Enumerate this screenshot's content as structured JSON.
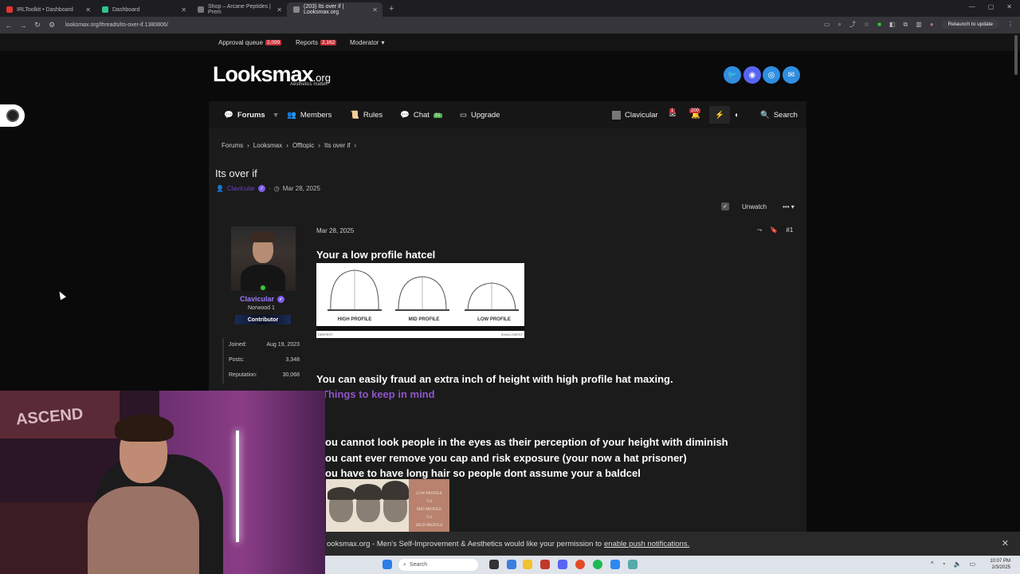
{
  "browser": {
    "tabs": [
      {
        "label": "IRLToolkit • Dashboard",
        "color": "#e3342f"
      },
      {
        "label": "Dashboard",
        "color": "#31c48d"
      },
      {
        "label": "Shop – Arcane Peptides | Prem",
        "color": "#777777"
      },
      {
        "label": "(203) Its over if | Looksmax.org",
        "color": "#888888"
      }
    ],
    "url": "looksmax.org/threads/its-over-if.1380806/",
    "relaunch": "Relaunch to update"
  },
  "modbar": {
    "approval_label": "Approval queue",
    "approval_count": "2,099",
    "reports_label": "Reports",
    "reports_count": "2,162",
    "moderator_label": "Moderator"
  },
  "site": {
    "logo_main": "Looksmax",
    "logo_org": ".org",
    "tagline": "Aesthetics matter."
  },
  "nav": {
    "forums": "Forums",
    "members": "Members",
    "rules": "Rules",
    "chat": "Chat",
    "chat_count": "31",
    "upgrade": "Upgrade",
    "username": "Clavicular",
    "msg_count": "1",
    "alert_count": "200",
    "search": "Search"
  },
  "breadcrumbs": [
    "Forums",
    "Looksmax",
    "Offtopic",
    "Its over if"
  ],
  "thread": {
    "title": "Its over if",
    "author": "Clavicular",
    "date": "Mar 28, 2025",
    "unwatch": "Unwatch"
  },
  "user": {
    "name": "Clavicular",
    "title": "Norwood 1",
    "banner": "Contributor",
    "stats": [
      {
        "label": "Joined:",
        "value": "Aug 19, 2023"
      },
      {
        "label": "Posts:",
        "value": "3,348"
      },
      {
        "label": "Reputation:",
        "value": "30,068"
      }
    ]
  },
  "post": {
    "date": "Mar 28, 2025",
    "number": "#1",
    "headline": "Your a low profile hatcel",
    "hat_labels": [
      "HIGH PROFILE",
      "MID PROFILE",
      "LOW PROFILE"
    ],
    "hat_footer_left": "DEEPEST",
    "hat_footer_right": "SHALLOWEST",
    "body1": "You can easily fraud an extra inch of height with high profile hat maxing.",
    "heading2": "Things to keep in mind",
    "bullets": [
      "ou cannot look people in the eyes as their perception of your height with diminish",
      "ou cant ever remove you cap and risk exposure (your now a hat prisoner)",
      "ou have to have long hair so people dont assume your a baldcel"
    ],
    "img2_labels": [
      "LOW PROFILE",
      "V.S",
      "MID PROFILE",
      "V.S",
      "HIGH PROFILE"
    ]
  },
  "notification": {
    "text": "ooksmax.org - Men's Self-Improvement & Aesthetics would like your permission to",
    "link": "enable push notifications."
  },
  "taskbar": {
    "search": "Search",
    "time": "10:07 PM",
    "date": "2/3/2025"
  },
  "webcam": {
    "banner": "ASCEND"
  }
}
